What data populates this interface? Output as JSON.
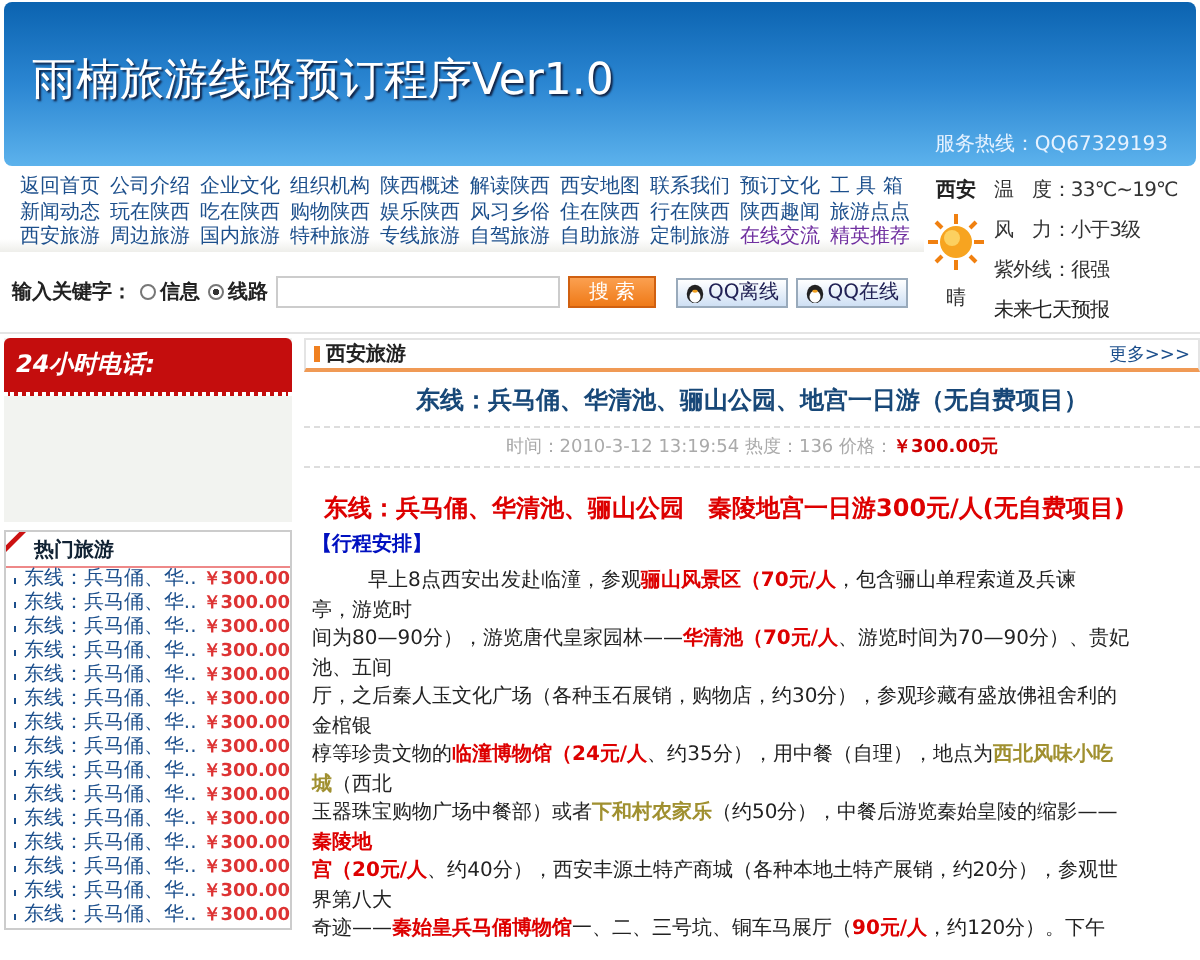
{
  "header": {
    "title": "雨楠旅游线路预订程序Ver1.0",
    "hotline": "服务热线：QQ67329193"
  },
  "nav": [
    {
      "label": "返回首页",
      "visited": false
    },
    {
      "label": "公司介绍",
      "visited": false
    },
    {
      "label": "企业文化",
      "visited": false
    },
    {
      "label": "组织机构",
      "visited": false
    },
    {
      "label": "陕西概述",
      "visited": false
    },
    {
      "label": "解读陕西",
      "visited": false
    },
    {
      "label": "西安地图",
      "visited": false
    },
    {
      "label": "联系我们",
      "visited": false
    },
    {
      "label": "预订文化",
      "visited": false
    },
    {
      "label": "工 具 箱",
      "visited": false
    },
    {
      "label": "新闻动态",
      "visited": false
    },
    {
      "label": "玩在陕西",
      "visited": false
    },
    {
      "label": "吃在陕西",
      "visited": false
    },
    {
      "label": "购物陕西",
      "visited": false
    },
    {
      "label": "娱乐陕西",
      "visited": false
    },
    {
      "label": "风习乡俗",
      "visited": false
    },
    {
      "label": "住在陕西",
      "visited": false
    },
    {
      "label": "行在陕西",
      "visited": false
    },
    {
      "label": "陕西趣闻",
      "visited": false
    },
    {
      "label": "旅游点点",
      "visited": false
    },
    {
      "label": "西安旅游",
      "visited": false
    },
    {
      "label": "周边旅游",
      "visited": false
    },
    {
      "label": "国内旅游",
      "visited": false
    },
    {
      "label": "特种旅游",
      "visited": false
    },
    {
      "label": "专线旅游",
      "visited": false
    },
    {
      "label": "自驾旅游",
      "visited": false
    },
    {
      "label": "自助旅游",
      "visited": false
    },
    {
      "label": "定制旅游",
      "visited": false
    },
    {
      "label": "在线交流",
      "visited": true
    },
    {
      "label": "精英推荐",
      "visited": true
    }
  ],
  "weather": {
    "city": "西安",
    "condition": "晴",
    "temperature": "温　度：33℃~19℃",
    "wind": "风　力：小于3级",
    "uv": "紫外线：很强",
    "forecast": "未来七天预报"
  },
  "search": {
    "label": "输入关键字：",
    "options": [
      {
        "label": "信息",
        "selected": false
      },
      {
        "label": "线路",
        "selected": true
      }
    ],
    "button": "搜 索",
    "qq_buttons": [
      "QQ离线",
      "QQ在线"
    ]
  },
  "sidebar": {
    "phone_title": "24小时电话:",
    "hot_title": "热门旅游",
    "hot_items": [
      {
        "name": "东线：兵马俑、华..",
        "price": "￥300.00"
      },
      {
        "name": "东线：兵马俑、华..",
        "price": "￥300.00"
      },
      {
        "name": "东线：兵马俑、华..",
        "price": "￥300.00"
      },
      {
        "name": "东线：兵马俑、华..",
        "price": "￥300.00"
      },
      {
        "name": "东线：兵马俑、华..",
        "price": "￥300.00"
      },
      {
        "name": "东线：兵马俑、华..",
        "price": "￥300.00"
      },
      {
        "name": "东线：兵马俑、华..",
        "price": "￥300.00"
      },
      {
        "name": "东线：兵马俑、华..",
        "price": "￥300.00"
      },
      {
        "name": "东线：兵马俑、华..",
        "price": "￥300.00"
      },
      {
        "name": "东线：兵马俑、华..",
        "price": "￥300.00"
      },
      {
        "name": "东线：兵马俑、华..",
        "price": "￥300.00"
      },
      {
        "name": "东线：兵马俑、华..",
        "price": "￥300.00"
      },
      {
        "name": "东线：兵马俑、华..",
        "price": "￥300.00"
      },
      {
        "name": "东线：兵马俑、华..",
        "price": "￥300.00"
      },
      {
        "name": "东线：兵马俑、华..",
        "price": "￥300.00"
      }
    ]
  },
  "main": {
    "section": "西安旅游",
    "more": "更多>>>",
    "title": "东线：兵马俑、华清池、骊山公园、地宫一日游（无自费项目）",
    "meta": "时间：2010-3-12 13:19:54 热度：136 价格：",
    "price": "￥300.00元",
    "subtitle": "东线：兵马俑、华清池、骊山公园　秦陵地宫一日游300元/人(无自费项目)",
    "schedule_title": "【行程安排】",
    "lines": [
      {
        "indent": true,
        "parts": [
          {
            "kind": "plain",
            "text": "早上8点西安出发赴临潼，参观"
          },
          {
            "kind": "sight",
            "text": "骊山风景区（70元/人"
          },
          {
            "kind": "plain",
            "text": "，包含骊山单程索道及兵谏"
          }
        ]
      },
      {
        "indent": false,
        "parts": [
          {
            "kind": "plain",
            "text": "亭，游览时"
          }
        ]
      },
      {
        "indent": false,
        "parts": [
          {
            "kind": "plain",
            "text": "间为80—90分），游览唐代皇家园林——"
          },
          {
            "kind": "sight",
            "text": "华清池（70元/人"
          },
          {
            "kind": "plain",
            "text": "、游览时间为70—90分）、贵妃"
          }
        ]
      },
      {
        "indent": false,
        "parts": [
          {
            "kind": "plain",
            "text": "池、五间"
          }
        ]
      },
      {
        "indent": false,
        "parts": [
          {
            "kind": "plain",
            "text": "厅，之后秦人玉文化广场（各种玉石展销，购物店，约30分），参观珍藏有盛放佛祖舍利的"
          }
        ]
      },
      {
        "indent": false,
        "parts": [
          {
            "kind": "plain",
            "text": "金棺银"
          }
        ]
      },
      {
        "indent": false,
        "parts": [
          {
            "kind": "plain",
            "text": "椁等珍贵文物的"
          },
          {
            "kind": "sight",
            "text": "临潼博物馆（24元/人"
          },
          {
            "kind": "plain",
            "text": "、约35分），用中餐（自理），地点为"
          },
          {
            "kind": "food",
            "text": "西北风味小吃"
          }
        ]
      },
      {
        "indent": false,
        "parts": [
          {
            "kind": "food",
            "text": "城"
          },
          {
            "kind": "plain",
            "text": "（西北"
          }
        ]
      },
      {
        "indent": false,
        "parts": [
          {
            "kind": "plain",
            "text": "玉器珠宝购物广场中餐部）或者"
          },
          {
            "kind": "food",
            "text": "下和村农家乐"
          },
          {
            "kind": "plain",
            "text": "（约50分），中餐后游览秦始皇陵的缩影——"
          }
        ]
      },
      {
        "indent": false,
        "parts": [
          {
            "kind": "sight",
            "text": "秦陵地"
          }
        ]
      },
      {
        "indent": false,
        "parts": [
          {
            "kind": "sight",
            "text": "宫（20元/人"
          },
          {
            "kind": "plain",
            "text": "、约40分），西安丰源土特产商城（各种本地土特产展销，约20分），参观世"
          }
        ]
      },
      {
        "indent": false,
        "parts": [
          {
            "kind": "plain",
            "text": "界第八大"
          }
        ]
      },
      {
        "indent": false,
        "parts": [
          {
            "kind": "plain",
            "text": "奇迹——"
          },
          {
            "kind": "sight",
            "text": "秦始皇兵马俑博物馆"
          },
          {
            "kind": "plain",
            "text": "一、二、三号坑、铜车马展厅（"
          },
          {
            "kind": "sight",
            "text": "90元/人"
          },
          {
            "kind": "plain",
            "text": "，约120分）。下午"
          }
        ]
      }
    ]
  }
}
